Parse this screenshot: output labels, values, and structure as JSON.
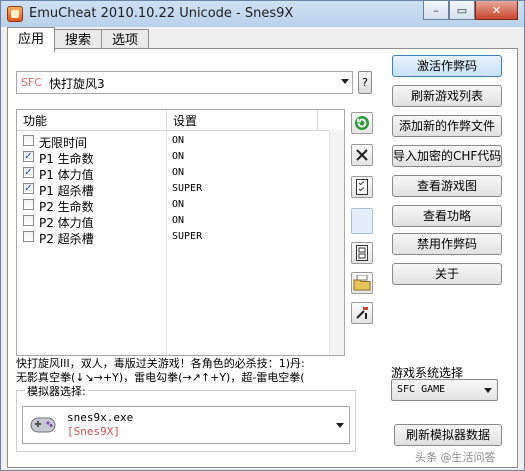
{
  "window": {
    "title": "EmuCheat 2010.10.22 Unicode - Snes9X"
  },
  "title_buttons": {
    "minimize": "–",
    "maximize": "▭",
    "close": "✕"
  },
  "tabs": [
    {
      "label": "应用"
    },
    {
      "label": "搜索"
    },
    {
      "label": "选项"
    }
  ],
  "game": {
    "platform": "SFC",
    "name": "快打旋风3",
    "help": "?"
  },
  "cheat_table": {
    "columns": [
      "功能",
      "设置"
    ],
    "rows": [
      {
        "checked": false,
        "feature": "无限时间",
        "value": "ON"
      },
      {
        "checked": true,
        "feature": "P1 生命数",
        "value": "ON"
      },
      {
        "checked": true,
        "feature": "P1 体力值",
        "value": "ON"
      },
      {
        "checked": true,
        "feature": "P1 超杀槽",
        "value": "SUPER"
      },
      {
        "checked": false,
        "feature": "P2 生命数",
        "value": "ON"
      },
      {
        "checked": false,
        "feature": "P2 体力值",
        "value": "ON"
      },
      {
        "checked": false,
        "feature": "P2 超杀槽",
        "value": "SUPER"
      }
    ]
  },
  "buttons": {
    "activate": "激活作弊码",
    "refresh_list": "刷新游戏列表",
    "add_cheat": "添加新的作弊文件",
    "import_chf": "导入加密的CHF代码",
    "view_image": "查看游戏图",
    "view_moves": "查看功略",
    "disable": "禁用作弊码",
    "about": "关于",
    "refresh_emu": "刷新模拟器数据"
  },
  "description": "快打旋风III，双人，毒版过关游戏！各角色的必杀技：1)丹:\n无影真空拳(↓↘→+Y)，雷电勾拳(→↗↑+Y)，超-雷电空拳(",
  "emulator": {
    "label": "模拟器选择:",
    "exe": "snes9x.exe",
    "name": "[Snes9X]"
  },
  "system": {
    "label": "游戏系统选择",
    "value": "SFC GAME"
  },
  "watermark": "头条 @生活问答",
  "colors": {
    "accent": "#3c7fb1",
    "platform": "#e06a6a"
  }
}
